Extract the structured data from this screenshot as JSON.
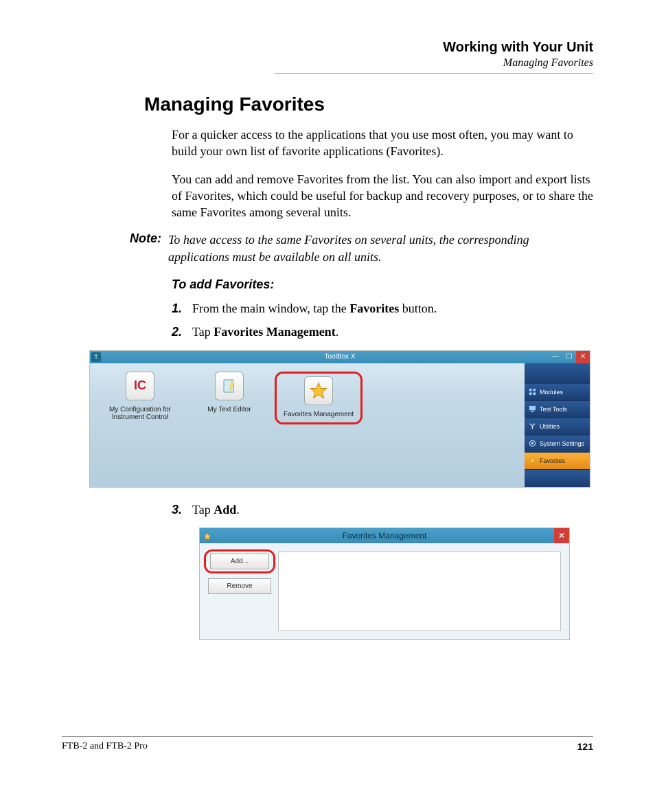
{
  "header": {
    "chapter": "Working with Your Unit",
    "section": "Managing Favorites"
  },
  "title": "Managing Favorites",
  "para1": "For a quicker access to the applications that you use most often, you may want to build your own list of favorite applications (Favorites).",
  "para2": "You can add and remove Favorites from the list. You can also import and export lists of Favorites, which could be useful for backup and recovery purposes, or to share the same Favorites among several units.",
  "note_label": "Note:",
  "note_text": "To have access to the same Favorites on several units, the corresponding applications must be available on all units.",
  "sub_heading": "To add Favorites:",
  "step1": {
    "num": "1.",
    "t1": "From the main window, tap the ",
    "b": "Favorites",
    "t2": " button."
  },
  "step2": {
    "num": "2.",
    "t1": "Tap ",
    "b": "Favorites Management",
    "t2": "."
  },
  "step3": {
    "num": "3.",
    "t1": "Tap ",
    "b": "Add",
    "t2": "."
  },
  "fig1": {
    "window_title": "ToolBox X",
    "items": [
      {
        "label": "My Configuration for Instrument Control",
        "icon": "ic"
      },
      {
        "label": "My Text Editor",
        "icon": "notepad"
      },
      {
        "label": "Favorites Management",
        "icon": "star"
      }
    ],
    "sidebar": [
      {
        "label": "Modules",
        "icon": "modules",
        "active": false
      },
      {
        "label": "Test Tools",
        "icon": "test",
        "active": false
      },
      {
        "label": "Utilities",
        "icon": "wrench",
        "active": false
      },
      {
        "label": "System Settings",
        "icon": "gear",
        "active": false
      },
      {
        "label": "Favorites",
        "icon": "star",
        "active": true
      }
    ]
  },
  "fig2": {
    "window_title": "Favorites Management",
    "add_label": "Add...",
    "remove_label": "Remove"
  },
  "footer": {
    "product": "FTB-2 and FTB-2 Pro",
    "page": "121"
  }
}
